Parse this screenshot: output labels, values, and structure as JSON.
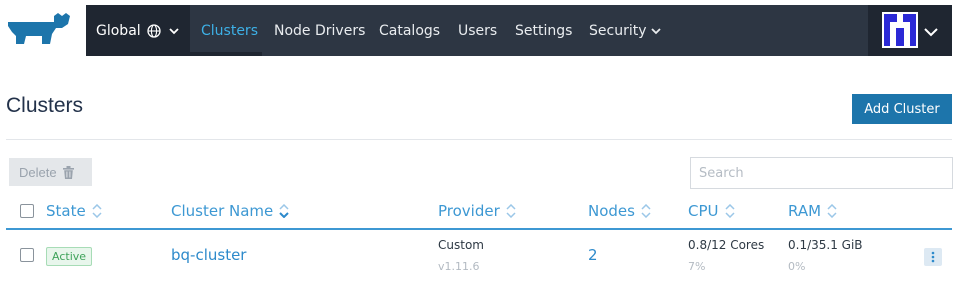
{
  "header": {
    "scope_label": "Global",
    "nav": [
      {
        "label": "Clusters",
        "active": true
      },
      {
        "label": "Node Drivers",
        "active": false
      },
      {
        "label": "Catalogs",
        "active": false
      },
      {
        "label": "Users",
        "active": false
      },
      {
        "label": "Settings",
        "active": false
      },
      {
        "label": "Security",
        "active": false
      }
    ],
    "icons": {
      "logo": "rancher-logo",
      "scope": "globe-icon",
      "user": "user-avatar"
    }
  },
  "page": {
    "title": "Clusters",
    "add_button": "Add Cluster"
  },
  "toolbar": {
    "delete_label": "Delete",
    "search_placeholder": "Search"
  },
  "table": {
    "columns": [
      "State",
      "Cluster Name",
      "Provider",
      "Nodes",
      "CPU",
      "RAM"
    ],
    "rows": [
      {
        "state": "Active",
        "name": "bq-cluster",
        "provider": "Custom",
        "provider_version": "v1.11.6",
        "nodes": "2",
        "cpu": "0.8/12 Cores",
        "cpu_pct": "7%",
        "ram": "0.1/35.1 GiB",
        "ram_pct": "0%"
      }
    ]
  },
  "colors": {
    "nav_bg": "#2d3643",
    "nav_dark": "#1f2631",
    "accent": "#3d98d3",
    "primary_button": "#1d75ab",
    "active_badge": "#3fa35b"
  }
}
